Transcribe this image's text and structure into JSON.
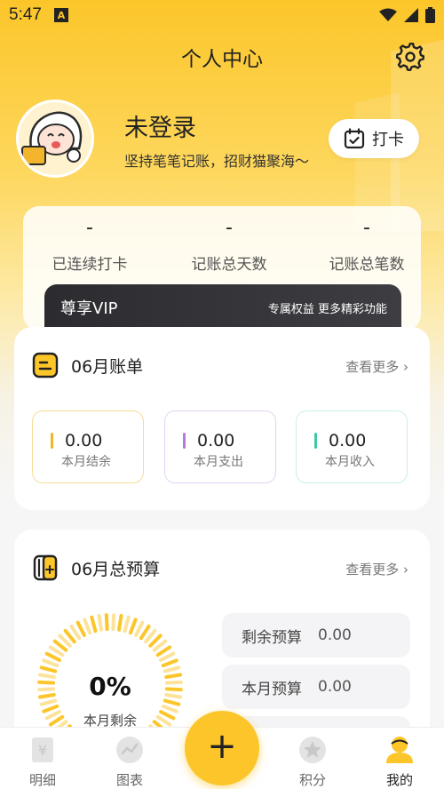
{
  "status_bar": {
    "time": "5:47",
    "notification_glyph": "A"
  },
  "header": {
    "title": "个人中心",
    "settings_icon": "gear-icon"
  },
  "profile": {
    "name": "未登录",
    "subtitle": "坚持笔笔记账，招财猫聚海～",
    "checkin_label": "打卡"
  },
  "stats": [
    {
      "value": "-",
      "label": "已连续打卡"
    },
    {
      "value": "-",
      "label": "记账总天数"
    },
    {
      "value": "-",
      "label": "记账总笔数"
    }
  ],
  "vip": {
    "title": "尊享VIP",
    "subtitle": "专属权益 更多精彩功能"
  },
  "bill": {
    "title": "06月账单",
    "more": "查看更多",
    "items": [
      {
        "value": "0.00",
        "label": "本月结余",
        "color": "#f0b52a"
      },
      {
        "value": "0.00",
        "label": "本月支出",
        "color": "#b57ad8"
      },
      {
        "value": "0.00",
        "label": "本月收入",
        "color": "#3ac9a6"
      }
    ]
  },
  "budget": {
    "title": "06月总预算",
    "more": "查看更多",
    "percent": "0%",
    "percent_label": "本月剩余",
    "items": [
      {
        "label": "剩余预算",
        "value": "0.00"
      },
      {
        "label": "本月预算",
        "value": "0.00"
      }
    ]
  },
  "tabbar": {
    "tabs": [
      {
        "label": "明细",
        "icon": "ledger-icon"
      },
      {
        "label": "图表",
        "icon": "chart-icon"
      },
      {
        "label": "积分",
        "icon": "star-icon"
      },
      {
        "label": "我的",
        "icon": "user-icon"
      }
    ],
    "fab_label": "+"
  },
  "colors": {
    "accent": "#fcc62a",
    "dark": "#2c2c30"
  }
}
